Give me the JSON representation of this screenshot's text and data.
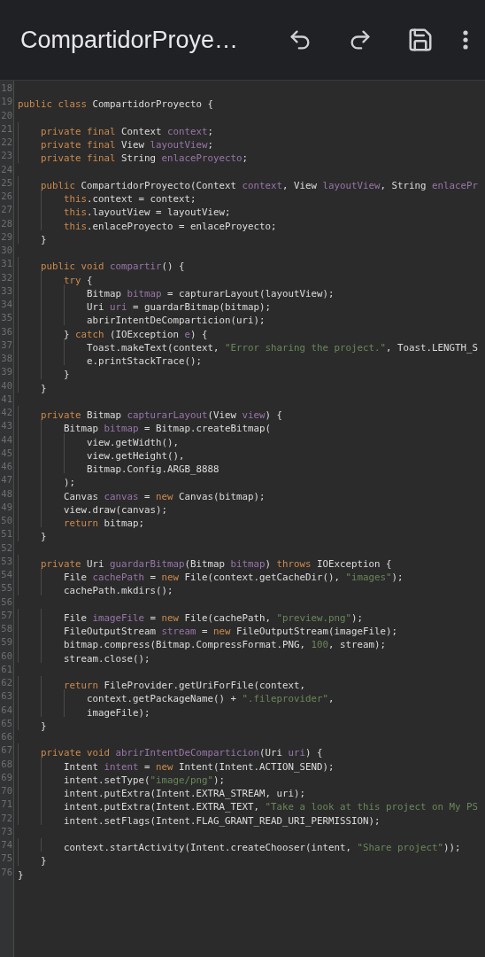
{
  "app_bar": {
    "title": "CompartidorProye…"
  },
  "editor": {
    "lines": [
      {
        "number": "18"
      },
      {
        "number": "19",
        "tokens": [
          {
            "kind": "keyword",
            "text": "public class"
          },
          {
            "kind": "plain",
            "text": " CompartidorProyecto {"
          }
        ]
      },
      {
        "number": "20"
      },
      {
        "number": "21",
        "tokens": [
          {
            "kind": "keyword",
            "text": "    private final"
          },
          {
            "kind": "plain",
            "text": " Context "
          },
          {
            "kind": "field",
            "text": "context"
          },
          {
            "kind": "plain",
            "text": ";"
          }
        ]
      },
      {
        "number": "22",
        "tokens": [
          {
            "kind": "keyword",
            "text": "    private final"
          },
          {
            "kind": "plain",
            "text": " View "
          },
          {
            "kind": "field",
            "text": "layoutView"
          },
          {
            "kind": "plain",
            "text": ";"
          }
        ]
      },
      {
        "number": "23",
        "tokens": [
          {
            "kind": "keyword",
            "text": "    private final"
          },
          {
            "kind": "plain",
            "text": " String "
          },
          {
            "kind": "field",
            "text": "enlaceProyecto"
          },
          {
            "kind": "plain",
            "text": ";"
          }
        ]
      },
      {
        "number": "24"
      },
      {
        "number": "25",
        "tokens": [
          {
            "kind": "keyword",
            "text": "    public"
          },
          {
            "kind": "plain",
            "text": " CompartidorProyecto(Context "
          },
          {
            "kind": "field",
            "text": "context"
          },
          {
            "kind": "plain",
            "text": ", View "
          },
          {
            "kind": "field",
            "text": "layoutView"
          },
          {
            "kind": "plain",
            "text": ", String "
          },
          {
            "kind": "field",
            "text": "enlacePr"
          }
        ]
      },
      {
        "number": "26",
        "tokens": [
          {
            "kind": "keyword",
            "text": "        this"
          },
          {
            "kind": "plain",
            "text": ".context = context;"
          }
        ]
      },
      {
        "number": "27",
        "tokens": [
          {
            "kind": "keyword",
            "text": "        this"
          },
          {
            "kind": "plain",
            "text": ".layoutView = layoutView;"
          }
        ]
      },
      {
        "number": "28",
        "tokens": [
          {
            "kind": "keyword",
            "text": "        this"
          },
          {
            "kind": "plain",
            "text": ".enlaceProyecto = enlaceProyecto;"
          }
        ]
      },
      {
        "number": "29",
        "tokens": [
          {
            "kind": "plain",
            "text": "    }"
          }
        ]
      },
      {
        "number": "30"
      },
      {
        "number": "31",
        "tokens": [
          {
            "kind": "keyword",
            "text": "    public void "
          },
          {
            "kind": "field",
            "text": "compartir"
          },
          {
            "kind": "plain",
            "text": "() {"
          }
        ]
      },
      {
        "number": "32",
        "tokens": [
          {
            "kind": "keyword",
            "text": "        try"
          },
          {
            "kind": "plain",
            "text": " {"
          }
        ]
      },
      {
        "number": "33",
        "tokens": [
          {
            "kind": "plain",
            "text": "            Bitmap "
          },
          {
            "kind": "field",
            "text": "bitmap"
          },
          {
            "kind": "plain",
            "text": " = capturarLayout(layoutView);"
          }
        ]
      },
      {
        "number": "34",
        "tokens": [
          {
            "kind": "plain",
            "text": "            Uri "
          },
          {
            "kind": "field",
            "text": "uri"
          },
          {
            "kind": "plain",
            "text": " = guardarBitmap(bitmap);"
          }
        ]
      },
      {
        "number": "35",
        "tokens": [
          {
            "kind": "plain",
            "text": "            abrirIntentDeComparticion(uri);"
          }
        ]
      },
      {
        "number": "36",
        "tokens": [
          {
            "kind": "plain",
            "text": "        } "
          },
          {
            "kind": "keyword",
            "text": "catch"
          },
          {
            "kind": "plain",
            "text": " (IOException "
          },
          {
            "kind": "field",
            "text": "e"
          },
          {
            "kind": "plain",
            "text": ") {"
          }
        ]
      },
      {
        "number": "37",
        "tokens": [
          {
            "kind": "plain",
            "text": "            Toast.makeText(context, "
          },
          {
            "kind": "string",
            "text": "\"Error sharing the project.\""
          },
          {
            "kind": "plain",
            "text": ", Toast.LENGTH_S"
          }
        ]
      },
      {
        "number": "38",
        "tokens": [
          {
            "kind": "plain",
            "text": "            e.printStackTrace();"
          }
        ]
      },
      {
        "number": "39",
        "tokens": [
          {
            "kind": "plain",
            "text": "        }"
          }
        ]
      },
      {
        "number": "40",
        "tokens": [
          {
            "kind": "plain",
            "text": "    }"
          }
        ]
      },
      {
        "number": "41"
      },
      {
        "number": "42",
        "tokens": [
          {
            "kind": "keyword",
            "text": "    private"
          },
          {
            "kind": "plain",
            "text": " Bitmap "
          },
          {
            "kind": "field",
            "text": "capturarLayout"
          },
          {
            "kind": "plain",
            "text": "(View "
          },
          {
            "kind": "field",
            "text": "view"
          },
          {
            "kind": "plain",
            "text": ") {"
          }
        ]
      },
      {
        "number": "43",
        "tokens": [
          {
            "kind": "plain",
            "text": "        Bitmap "
          },
          {
            "kind": "field",
            "text": "bitmap"
          },
          {
            "kind": "plain",
            "text": " = Bitmap.createBitmap("
          }
        ]
      },
      {
        "number": "44",
        "tokens": [
          {
            "kind": "plain",
            "text": "            view.getWidth(),"
          }
        ]
      },
      {
        "number": "45",
        "tokens": [
          {
            "kind": "plain",
            "text": "            view.getHeight(),"
          }
        ]
      },
      {
        "number": "46",
        "tokens": [
          {
            "kind": "plain",
            "text": "            Bitmap.Config.ARGB_8888"
          }
        ]
      },
      {
        "number": "47",
        "tokens": [
          {
            "kind": "plain",
            "text": "        );"
          }
        ]
      },
      {
        "number": "48",
        "tokens": [
          {
            "kind": "plain",
            "text": "        Canvas "
          },
          {
            "kind": "field",
            "text": "canvas"
          },
          {
            "kind": "plain",
            "text": " = "
          },
          {
            "kind": "keyword",
            "text": "new"
          },
          {
            "kind": "plain",
            "text": " Canvas(bitmap);"
          }
        ]
      },
      {
        "number": "49",
        "tokens": [
          {
            "kind": "plain",
            "text": "        view.draw(canvas);"
          }
        ]
      },
      {
        "number": "50",
        "tokens": [
          {
            "kind": "keyword",
            "text": "        return"
          },
          {
            "kind": "plain",
            "text": " bitmap;"
          }
        ]
      },
      {
        "number": "51",
        "tokens": [
          {
            "kind": "plain",
            "text": "    }"
          }
        ]
      },
      {
        "number": "52"
      },
      {
        "number": "53",
        "tokens": [
          {
            "kind": "keyword",
            "text": "    private"
          },
          {
            "kind": "plain",
            "text": " Uri "
          },
          {
            "kind": "field",
            "text": "guardarBitmap"
          },
          {
            "kind": "plain",
            "text": "(Bitmap "
          },
          {
            "kind": "field",
            "text": "bitmap"
          },
          {
            "kind": "plain",
            "text": ") "
          },
          {
            "kind": "keyword",
            "text": "throws"
          },
          {
            "kind": "plain",
            "text": " IOException {"
          }
        ]
      },
      {
        "number": "54",
        "tokens": [
          {
            "kind": "plain",
            "text": "        File "
          },
          {
            "kind": "field",
            "text": "cachePath"
          },
          {
            "kind": "plain",
            "text": " = "
          },
          {
            "kind": "keyword",
            "text": "new"
          },
          {
            "kind": "plain",
            "text": " File(context.getCacheDir(), "
          },
          {
            "kind": "string",
            "text": "\"images\""
          },
          {
            "kind": "plain",
            "text": ");"
          }
        ]
      },
      {
        "number": "55",
        "tokens": [
          {
            "kind": "plain",
            "text": "        cachePath.mkdirs();"
          }
        ]
      },
      {
        "number": "56"
      },
      {
        "number": "57",
        "tokens": [
          {
            "kind": "plain",
            "text": "        File "
          },
          {
            "kind": "field",
            "text": "imageFile"
          },
          {
            "kind": "plain",
            "text": " = "
          },
          {
            "kind": "keyword",
            "text": "new"
          },
          {
            "kind": "plain",
            "text": " File(cachePath, "
          },
          {
            "kind": "string",
            "text": "\"preview.png\""
          },
          {
            "kind": "plain",
            "text": ");"
          }
        ]
      },
      {
        "number": "58",
        "tokens": [
          {
            "kind": "plain",
            "text": "        FileOutputStream "
          },
          {
            "kind": "field",
            "text": "stream"
          },
          {
            "kind": "plain",
            "text": " = "
          },
          {
            "kind": "keyword",
            "text": "new"
          },
          {
            "kind": "plain",
            "text": " FileOutputStream(imageFile);"
          }
        ]
      },
      {
        "number": "59",
        "tokens": [
          {
            "kind": "plain",
            "text": "        bitmap.compress(Bitmap.CompressFormat.PNG, "
          },
          {
            "kind": "number",
            "text": "100"
          },
          {
            "kind": "plain",
            "text": ", stream);"
          }
        ]
      },
      {
        "number": "60",
        "tokens": [
          {
            "kind": "plain",
            "text": "        stream.close();"
          }
        ]
      },
      {
        "number": "61"
      },
      {
        "number": "62",
        "tokens": [
          {
            "kind": "keyword",
            "text": "        return"
          },
          {
            "kind": "plain",
            "text": " FileProvider.getUriForFile(context,"
          }
        ]
      },
      {
        "number": "63",
        "tokens": [
          {
            "kind": "plain",
            "text": "            context.getPackageName() + "
          },
          {
            "kind": "string",
            "text": "\".fileprovider\""
          },
          {
            "kind": "plain",
            "text": ","
          }
        ]
      },
      {
        "number": "64",
        "tokens": [
          {
            "kind": "plain",
            "text": "            imageFile);"
          }
        ]
      },
      {
        "number": "65",
        "tokens": [
          {
            "kind": "plain",
            "text": "    }"
          }
        ]
      },
      {
        "number": "66"
      },
      {
        "number": "67",
        "tokens": [
          {
            "kind": "keyword",
            "text": "    private void "
          },
          {
            "kind": "field",
            "text": "abrirIntentDeComparticion"
          },
          {
            "kind": "plain",
            "text": "(Uri "
          },
          {
            "kind": "field",
            "text": "uri"
          },
          {
            "kind": "plain",
            "text": ") {"
          }
        ]
      },
      {
        "number": "68",
        "tokens": [
          {
            "kind": "plain",
            "text": "        Intent "
          },
          {
            "kind": "field",
            "text": "intent"
          },
          {
            "kind": "plain",
            "text": " = "
          },
          {
            "kind": "keyword",
            "text": "new"
          },
          {
            "kind": "plain",
            "text": " Intent(Intent.ACTION_SEND);"
          }
        ]
      },
      {
        "number": "69",
        "tokens": [
          {
            "kind": "plain",
            "text": "        intent.setType("
          },
          {
            "kind": "string",
            "text": "\"image/png\""
          },
          {
            "kind": "plain",
            "text": ");"
          }
        ]
      },
      {
        "number": "70",
        "tokens": [
          {
            "kind": "plain",
            "text": "        intent.putExtra(Intent.EXTRA_STREAM, uri);"
          }
        ]
      },
      {
        "number": "71",
        "tokens": [
          {
            "kind": "plain",
            "text": "        intent.putExtra(Intent.EXTRA_TEXT, "
          },
          {
            "kind": "string",
            "text": "\"Take a look at this project on My PS"
          }
        ]
      },
      {
        "number": "72",
        "tokens": [
          {
            "kind": "plain",
            "text": "        intent.setFlags(Intent.FLAG_GRANT_READ_URI_PERMISSION);"
          }
        ]
      },
      {
        "number": "73"
      },
      {
        "number": "74",
        "tokens": [
          {
            "kind": "plain",
            "text": "        context.startActivity(Intent.createChooser(intent, "
          },
          {
            "kind": "string",
            "text": "\"Share project\""
          },
          {
            "kind": "plain",
            "text": "));"
          }
        ]
      },
      {
        "number": "75",
        "tokens": [
          {
            "kind": "plain",
            "text": "    }"
          }
        ]
      },
      {
        "number": "76",
        "tokens": [
          {
            "kind": "plain",
            "text": "}"
          }
        ]
      }
    ]
  }
}
